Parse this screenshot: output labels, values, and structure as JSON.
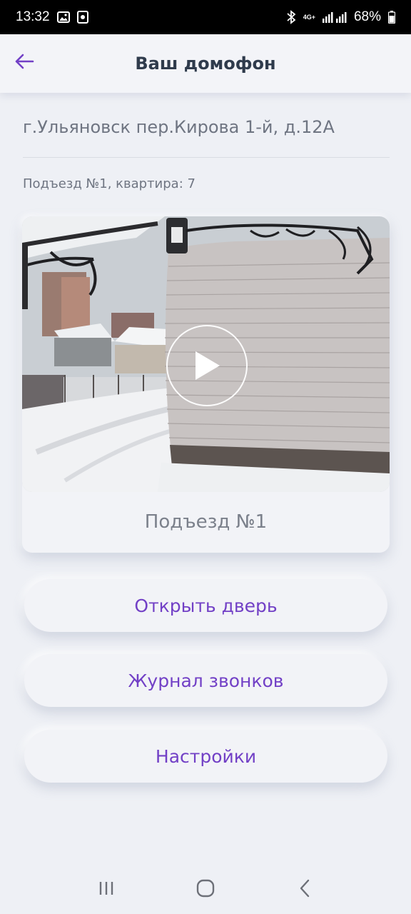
{
  "status_bar": {
    "time": "13:32",
    "network": "4G+",
    "battery": "68%",
    "icons": [
      "gallery-icon",
      "screen-record-icon",
      "bluetooth-icon",
      "signal-icon",
      "battery-icon"
    ]
  },
  "app_bar": {
    "title": "Ваш домофон",
    "back_icon": "arrow-left-icon"
  },
  "address": {
    "full": "г.Ульяновск пер.Кирова 1-й, д.12А",
    "entrance_apartment": "Подъезд №1, квартира: 7"
  },
  "camera": {
    "label": "Подъезд №1",
    "play_icon": "play-icon"
  },
  "actions": {
    "open_door": "Открыть дверь",
    "call_log": "Журнал звонков",
    "settings": "Настройки"
  },
  "nav": {
    "icons": [
      "recent-apps-icon",
      "home-icon",
      "back-icon"
    ]
  },
  "colors": {
    "accent": "#7240c6",
    "background": "#eef0f5",
    "title": "#2f3b4c"
  }
}
